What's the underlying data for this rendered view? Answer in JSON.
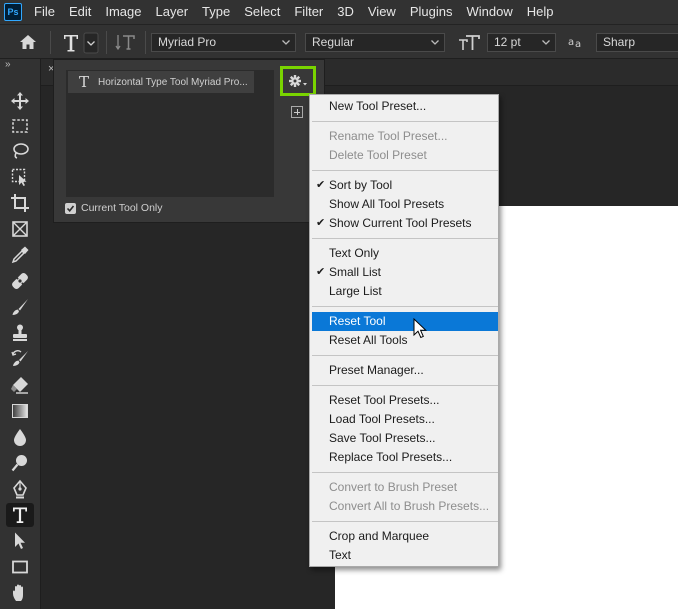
{
  "app": {
    "logo_text": "Ps"
  },
  "menubar": [
    "File",
    "Edit",
    "Image",
    "Layer",
    "Type",
    "Select",
    "Filter",
    "3D",
    "View",
    "Plugins",
    "Window",
    "Help"
  ],
  "options_bar": {
    "font_family": "Myriad Pro",
    "font_style": "Regular",
    "font_size": "12 pt",
    "antialias": "Sharp",
    "icons": [
      "home-icon",
      "type-tool-icon",
      "toggle-orientation-icon",
      "font-size-icon",
      "antialias-icon"
    ]
  },
  "toolbox": {
    "collapse_glyph": "»",
    "tools": [
      "move",
      "rectangular-marquee",
      "lasso",
      "object-selection",
      "crop",
      "frame",
      "eyedropper",
      "spot-healing",
      "brush",
      "clone-stamp",
      "history-brush",
      "eraser",
      "gradient",
      "blur",
      "dodge",
      "pen",
      "horizontal-type",
      "path-selection",
      "rectangle",
      "hand"
    ],
    "active_tool": "horizontal-type"
  },
  "document": {
    "tab_close": "×"
  },
  "preset_panel": {
    "preset_icon": "T",
    "preset_label": "Horizontal Type Tool Myriad Pro...",
    "current_tool_only_label": "Current Tool Only",
    "current_tool_only_checked": true
  },
  "context_menu": {
    "items": [
      {
        "label": "New Tool Preset...",
        "checked": false,
        "disabled": false,
        "highlighted": false,
        "sep_after": true
      },
      {
        "label": "Rename Tool Preset...",
        "checked": false,
        "disabled": true,
        "highlighted": false,
        "sep_after": false
      },
      {
        "label": "Delete Tool Preset",
        "checked": false,
        "disabled": true,
        "highlighted": false,
        "sep_after": true
      },
      {
        "label": "Sort by Tool",
        "checked": true,
        "disabled": false,
        "highlighted": false,
        "sep_after": false
      },
      {
        "label": "Show All Tool Presets",
        "checked": false,
        "disabled": false,
        "highlighted": false,
        "sep_after": false
      },
      {
        "label": "Show Current Tool Presets",
        "checked": true,
        "disabled": false,
        "highlighted": false,
        "sep_after": true
      },
      {
        "label": "Text Only",
        "checked": false,
        "disabled": false,
        "highlighted": false,
        "sep_after": false
      },
      {
        "label": "Small List",
        "checked": true,
        "disabled": false,
        "highlighted": false,
        "sep_after": false
      },
      {
        "label": "Large List",
        "checked": false,
        "disabled": false,
        "highlighted": false,
        "sep_after": true
      },
      {
        "label": "Reset Tool",
        "checked": false,
        "disabled": false,
        "highlighted": true,
        "sep_after": false
      },
      {
        "label": "Reset All Tools",
        "checked": false,
        "disabled": false,
        "highlighted": false,
        "sep_after": true
      },
      {
        "label": "Preset Manager...",
        "checked": false,
        "disabled": false,
        "highlighted": false,
        "sep_after": true
      },
      {
        "label": "Reset Tool Presets...",
        "checked": false,
        "disabled": false,
        "highlighted": false,
        "sep_after": false
      },
      {
        "label": "Load Tool Presets...",
        "checked": false,
        "disabled": false,
        "highlighted": false,
        "sep_after": false
      },
      {
        "label": "Save Tool Presets...",
        "checked": false,
        "disabled": false,
        "highlighted": false,
        "sep_after": false
      },
      {
        "label": "Replace Tool Presets...",
        "checked": false,
        "disabled": false,
        "highlighted": false,
        "sep_after": true
      },
      {
        "label": "Convert to Brush Preset",
        "checked": false,
        "disabled": true,
        "highlighted": false,
        "sep_after": false
      },
      {
        "label": "Convert All to Brush Presets...",
        "checked": false,
        "disabled": true,
        "highlighted": false,
        "sep_after": true
      },
      {
        "label": "Crop and Marquee",
        "checked": false,
        "disabled": false,
        "highlighted": false,
        "sep_after": false
      },
      {
        "label": "Text",
        "checked": false,
        "disabled": false,
        "highlighted": false,
        "sep_after": false
      }
    ],
    "check_glyph": "✔"
  },
  "colors": {
    "highlight": "#0a78d7",
    "gear_outline": "#79d400",
    "ps_blue": "#31a8ff"
  }
}
